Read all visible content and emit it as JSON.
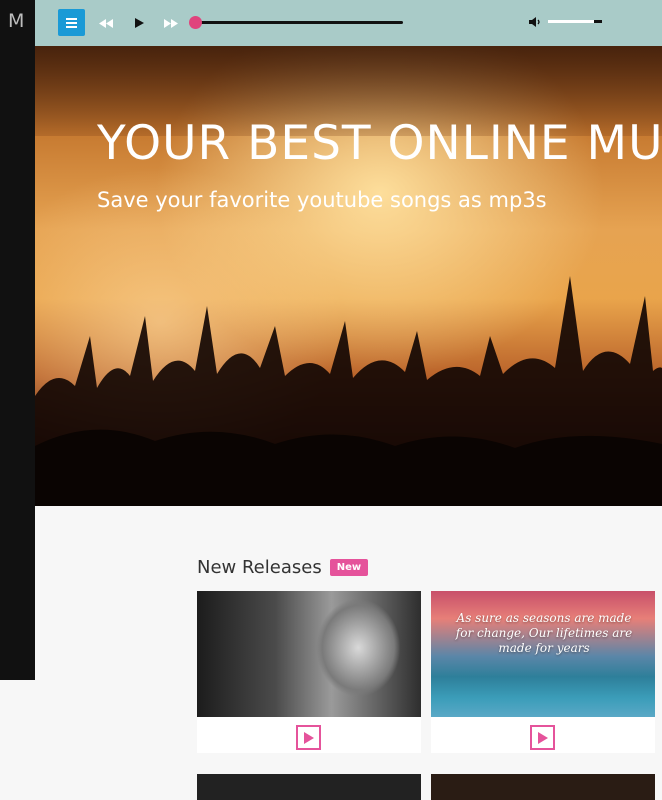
{
  "sidebar": {
    "logo": "M"
  },
  "player": {
    "menu_icon": "hamburger-icon",
    "prev_icon": "rewind-icon",
    "play_icon": "play-icon",
    "next_icon": "fast-forward-icon",
    "progress": 0.0,
    "volume": 0.85,
    "accent_color": "#e0447d",
    "menu_color": "#1a9ad6"
  },
  "hero": {
    "title": "YOUR BEST ONLINE MU",
    "subtitle": "Save your favorite youtube songs as mp3s"
  },
  "releases": {
    "title": "New Releases",
    "badge": "New",
    "badge_color": "#e5539b",
    "cards": [
      {
        "quote": ""
      },
      {
        "quote": "As sure as seasons are made for change, Our lifetimes are made for years"
      }
    ]
  }
}
